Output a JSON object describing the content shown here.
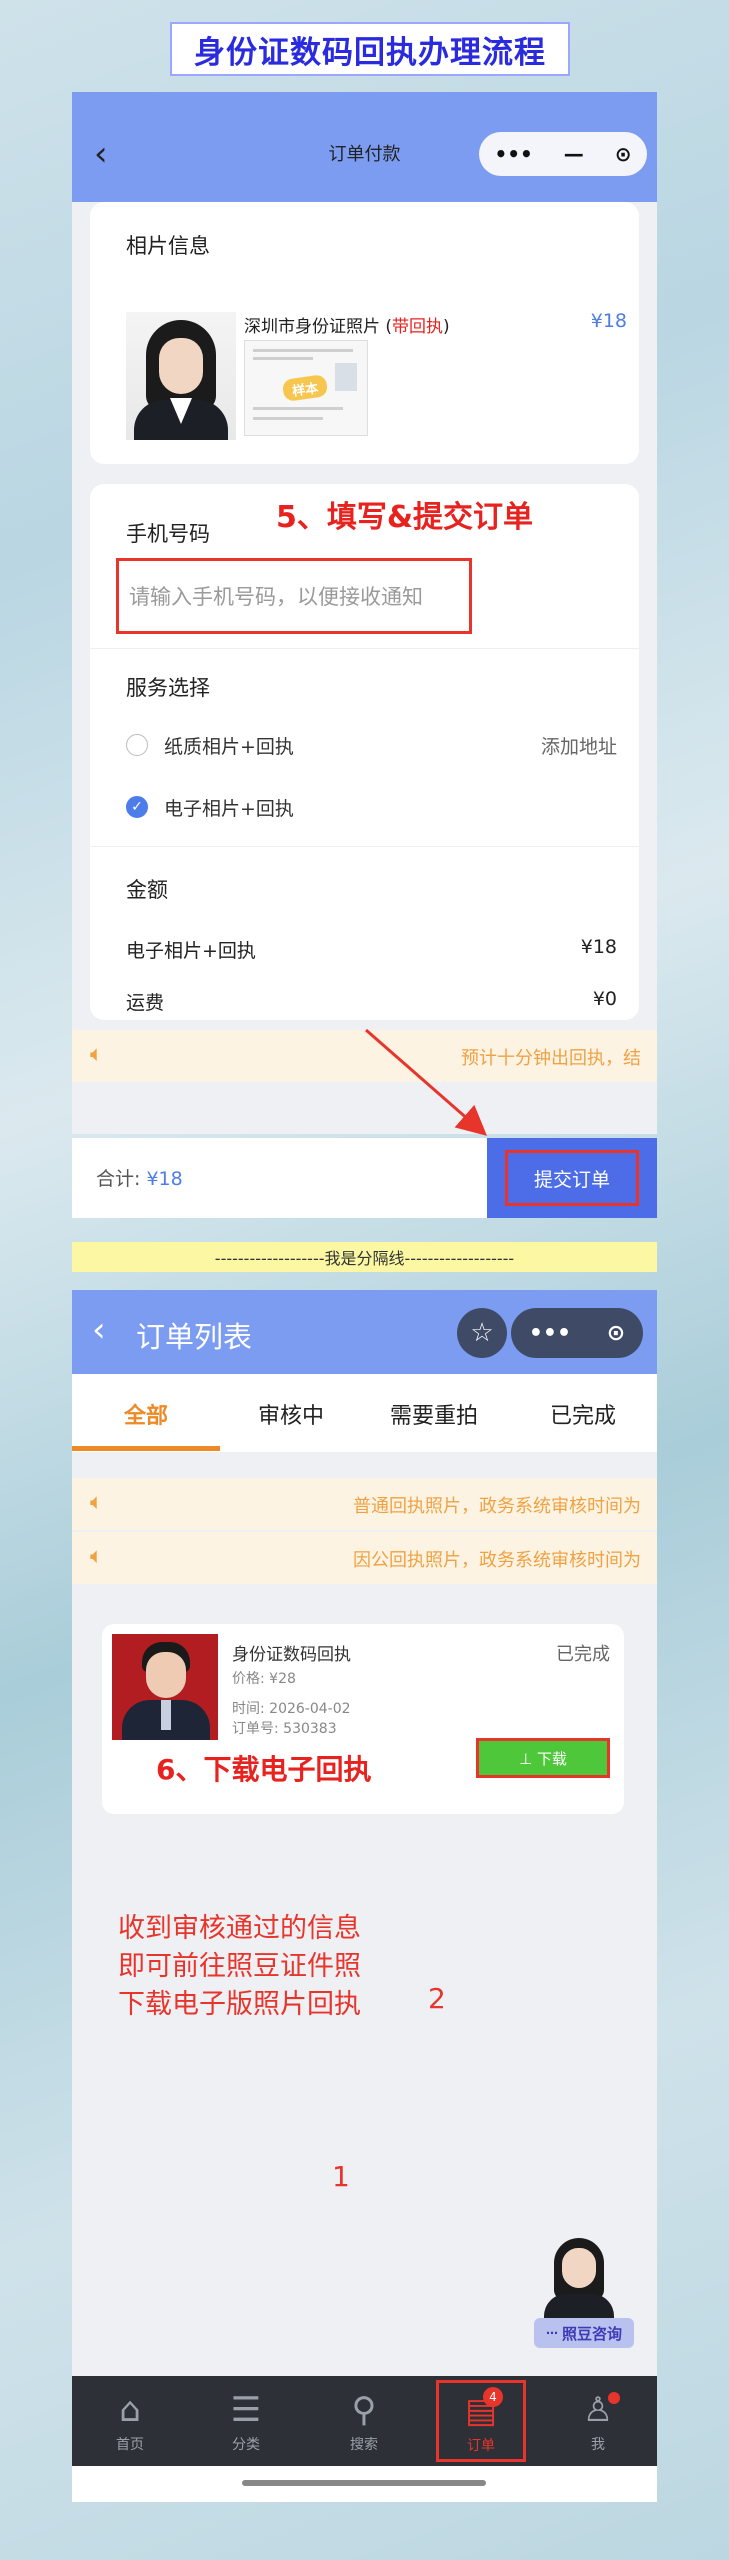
{
  "guide_title": "身份证数码回执办理流程",
  "screen1": {
    "nav_title": "订单付款",
    "back_icon": "‹",
    "capsule": {
      "more": "•••",
      "minus": "—",
      "close": "⊙"
    },
    "photo_section_title": "相片信息",
    "product_name_prefix": "深圳市身份证照片 (",
    "product_name_highlight": "带回执",
    "product_name_suffix": ")",
    "product_price": "¥18",
    "receipt_stamp": "样本",
    "phone_label": "手机号码",
    "annotation_step5": "5、填写&提交订单",
    "phone_placeholder": "请输入手机号码，以便接收通知",
    "service_label": "服务选择",
    "option_paper": "纸质相片+回执",
    "add_address": "添加地址",
    "option_electronic": "电子相片+回执",
    "amount_label": "金额",
    "line_item_label": "电子相片+回执",
    "line_item_price": "¥18",
    "shipping_label": "运费",
    "shipping_price": "¥0",
    "notice_text": "预计十分钟出回执，结",
    "total_label": "合计:",
    "total_value": "¥18",
    "submit_label": "提交订单"
  },
  "divider_text": "-------------------我是分隔线-------------------",
  "screen2": {
    "nav_title": "订单列表",
    "star_icon": "☆",
    "capsule": {
      "more": "•••",
      "close": "⊙"
    },
    "tabs": [
      "全部",
      "审核中",
      "需要重拍",
      "已完成"
    ],
    "notice1": "普通回执照片，政务系统审核时间为",
    "notice2": "因公回执照片，政务系统审核时间为",
    "order": {
      "title": "身份证数码回执",
      "status": "已完成",
      "price": "价格: ¥28",
      "time": "时间: 2026-04-02",
      "order_no": "订单号: 530383",
      "download_label": "⊥ 下载"
    },
    "annotation_step6": "6、下载电子回执",
    "instruction_lines": [
      "收到审核通过的信息",
      "即可前往照豆证件照",
      "下载电子版照片回执"
    ],
    "marker_1": "1",
    "marker_2": "2",
    "consult_label": "照豆咨询",
    "tabbar": [
      {
        "label": "首页",
        "icon": "home-icon"
      },
      {
        "label": "分类",
        "icon": "category-icon"
      },
      {
        "label": "搜索",
        "icon": "search-icon"
      },
      {
        "label": "订单",
        "icon": "order-icon",
        "badge": "4"
      },
      {
        "label": "我",
        "icon": "user-icon"
      }
    ]
  }
}
